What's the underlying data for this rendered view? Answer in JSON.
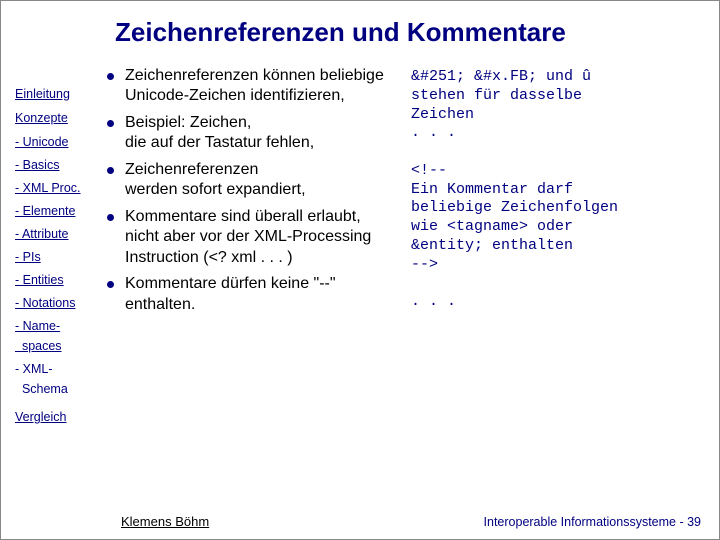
{
  "title": "Zeichenreferenzen und Kommentare",
  "sidebar": {
    "items": [
      {
        "label": "Einleitung",
        "link": true,
        "indent": false
      },
      {
        "label": "Konzepte",
        "link": true,
        "indent": false
      },
      {
        "label": "- Unicode",
        "link": true,
        "indent": true
      },
      {
        "label": "- Basics",
        "link": true,
        "indent": true
      },
      {
        "label": "- XML Proc.",
        "link": true,
        "indent": true
      },
      {
        "label": "- Elemente",
        "link": true,
        "indent": true
      },
      {
        "label": "- Attribute",
        "link": true,
        "indent": true
      },
      {
        "label": "- PIs",
        "link": true,
        "indent": true
      },
      {
        "label": "- Entities",
        "link": true,
        "indent": true
      },
      {
        "label": "- Notations",
        "link": true,
        "indent": true
      },
      {
        "label": "- Name-\n  spaces",
        "link": true,
        "indent": true
      },
      {
        "label": "- XML-\n  Schema",
        "link": false,
        "indent": true
      },
      {
        "label": "Vergleich",
        "link": true,
        "indent": false
      }
    ]
  },
  "bullets": [
    "Zeichenreferenzen können beliebige Unicode-Zeichen identifizieren,",
    "Beispiel: Zeichen,\ndie auf der Tastatur fehlen,",
    "Zeichenreferenzen\nwerden sofort expandiert,",
    "Kommentare sind überall erlaubt, nicht aber vor der XML-Processing Instruction (<? xml . . . )",
    "Kommentare dürfen keine \"--\" enthalten."
  ],
  "code": "&#251; &#x.FB; und û\nstehen für dasselbe\nZeichen\n. . .\n\n<!--\nEin Kommentar darf\nbeliebige Zeichenfolgen\nwie <tagname> oder\n&entity; enthalten\n-->\n\n. . .",
  "footer": {
    "author": "Klemens Böhm",
    "pageinfo": "Interoperable Informationssysteme - 39"
  }
}
